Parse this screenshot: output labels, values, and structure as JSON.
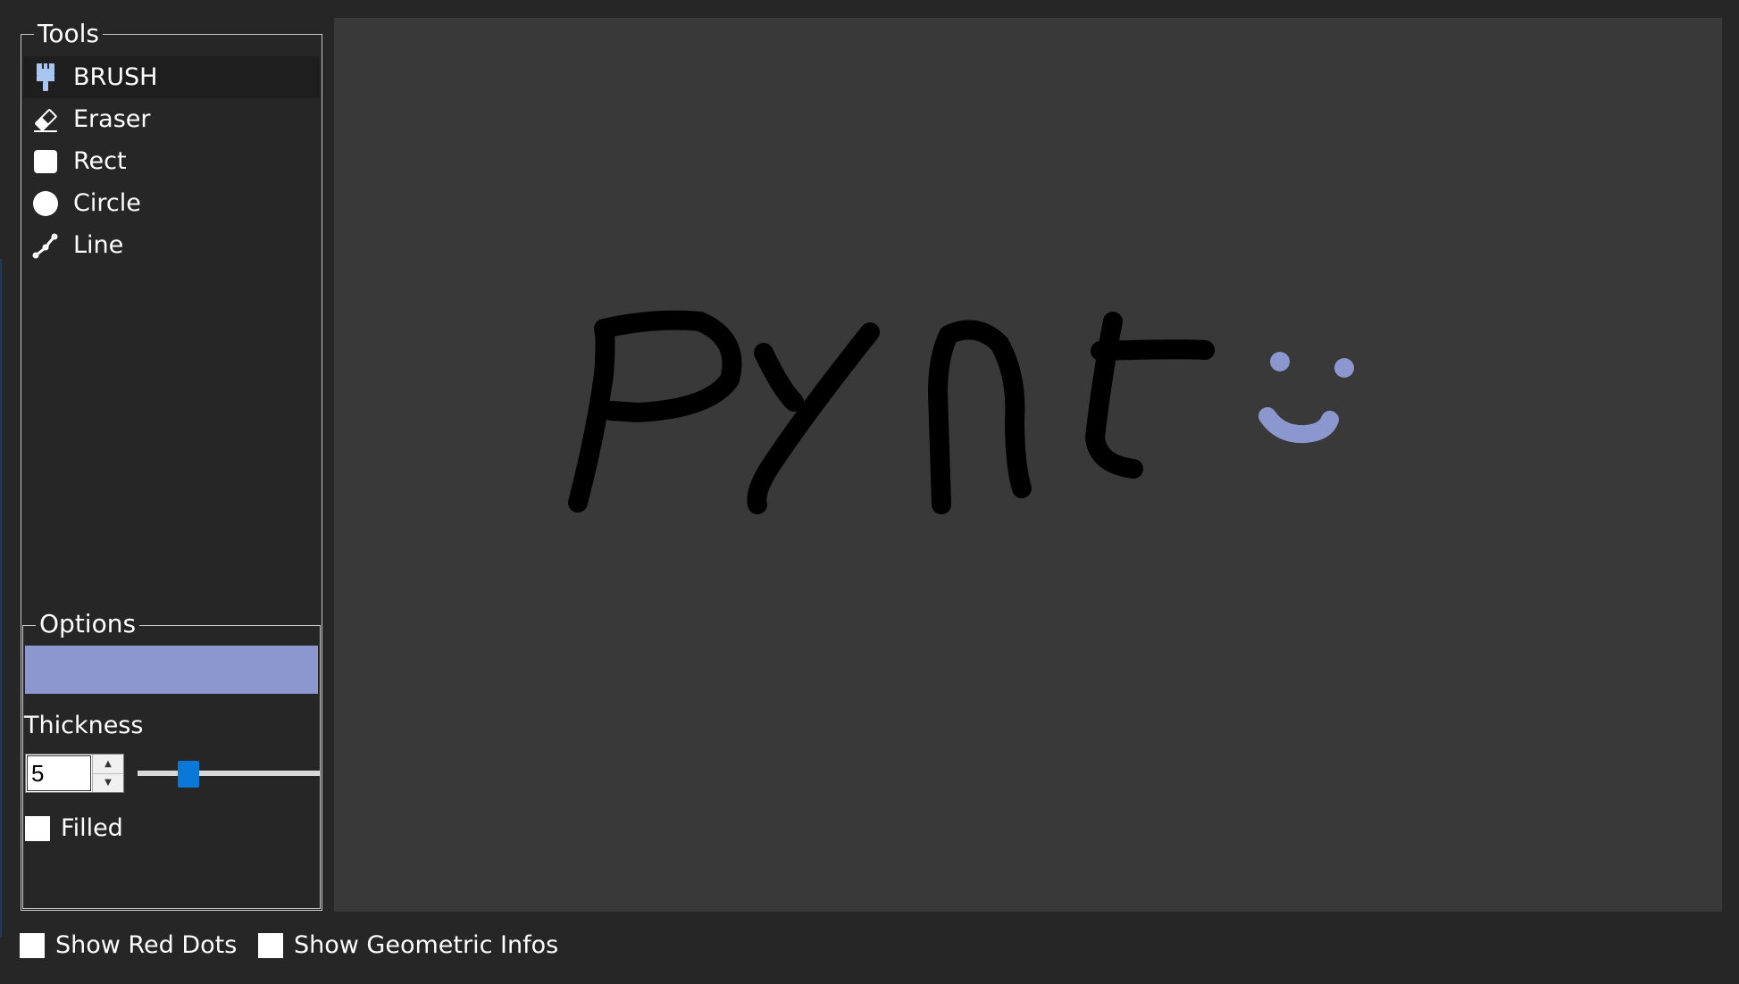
{
  "tools": {
    "title": "Tools",
    "selected": "brush",
    "items": [
      {
        "id": "brush",
        "label": "BRUSH",
        "icon": "brush-icon"
      },
      {
        "id": "eraser",
        "label": "Eraser",
        "icon": "eraser-icon"
      },
      {
        "id": "rect",
        "label": "Rect",
        "icon": "square-icon"
      },
      {
        "id": "circle",
        "label": "Circle",
        "icon": "circle-icon"
      },
      {
        "id": "line",
        "label": "Line",
        "icon": "line-icon"
      }
    ]
  },
  "options": {
    "title": "Options",
    "color": "#8c97cf",
    "thickness_label": "Thickness",
    "thickness_value": "5",
    "slider_fraction": 0.28,
    "filled_label": "Filled",
    "filled_checked": false
  },
  "bottom": {
    "show_red_dots_label": "Show Red Dots",
    "show_geometric_infos_label": "Show Geometric Infos"
  },
  "canvas": {
    "background": "#393939",
    "stroke_colors": {
      "text": "#000000",
      "smiley": "#8c97cf"
    }
  },
  "colors": {
    "window_bg": "#262626",
    "icon_accent": "#a9c6f0",
    "slider_handle": "#0a78d7"
  }
}
